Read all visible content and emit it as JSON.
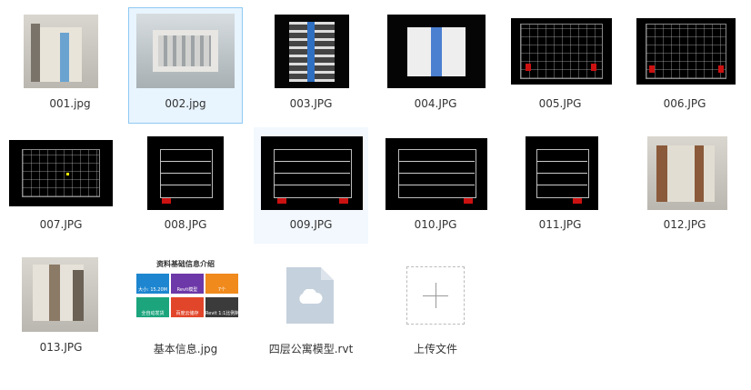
{
  "files": [
    {
      "name": "001.jpg"
    },
    {
      "name": "002.jpg"
    },
    {
      "name": "003.JPG"
    },
    {
      "name": "004.JPG"
    },
    {
      "name": "005.JPG"
    },
    {
      "name": "006.JPG"
    },
    {
      "name": "007.JPG"
    },
    {
      "name": "008.JPG"
    },
    {
      "name": "009.JPG"
    },
    {
      "name": "010.JPG"
    },
    {
      "name": "011.JPG"
    },
    {
      "name": "012.JPG"
    },
    {
      "name": "013.JPG"
    },
    {
      "name": "基本信息.jpg"
    },
    {
      "name": "四层公寓模型.rvt"
    }
  ],
  "info_image": {
    "title": "资料基础信息介绍",
    "tiles": [
      "大小: 15.20M",
      "Revit模型",
      "7个",
      "全自动发货",
      "百度云储存",
      "Revit 1:1比例制作"
    ]
  },
  "upload": {
    "label": "上传文件"
  },
  "colors": {
    "selected_bg": "#e8f4fe",
    "selected_border": "#8ec9f3",
    "file_icon": "#c5d1dd"
  }
}
